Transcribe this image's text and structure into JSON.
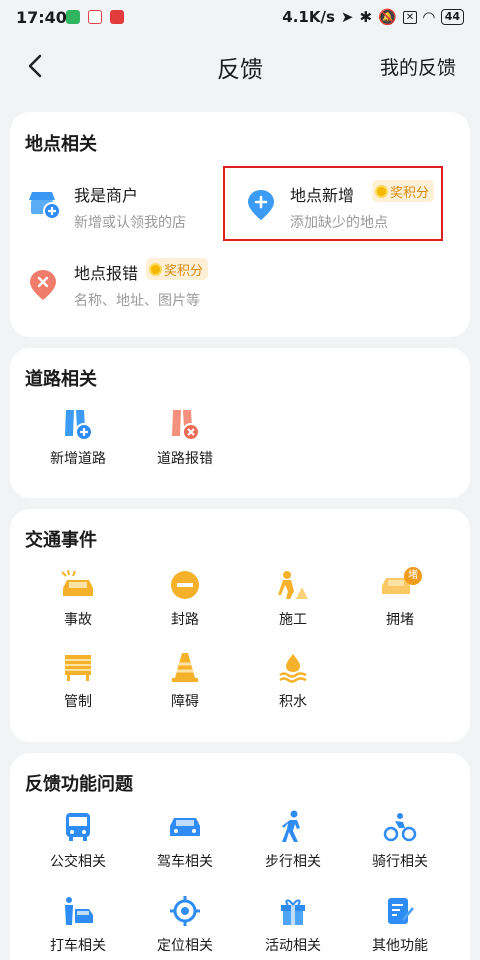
{
  "status_bar": {
    "time": "17:40",
    "network_speed": "4.1K/s",
    "battery": "44"
  },
  "nav": {
    "title": "反馈",
    "my_feedback": "我的反馈"
  },
  "location_section": {
    "title": "地点相关",
    "items": [
      {
        "label": "我是商户",
        "subtitle": "新增或认领我的店"
      },
      {
        "label": "地点新增",
        "subtitle": "添加缺少的地点",
        "badge": "奖积分"
      },
      {
        "label": "地点报错",
        "subtitle": "名称、地址、图片等",
        "badge": "奖积分"
      }
    ]
  },
  "road_section": {
    "title": "道路相关",
    "items": [
      {
        "label": "新增道路"
      },
      {
        "label": "道路报错"
      }
    ]
  },
  "traffic_section": {
    "title": "交通事件",
    "items": [
      {
        "label": "事故"
      },
      {
        "label": "封路"
      },
      {
        "label": "施工"
      },
      {
        "label": "拥堵",
        "icon_text": "堵"
      },
      {
        "label": "管制"
      },
      {
        "label": "障碍"
      },
      {
        "label": "积水"
      }
    ]
  },
  "feature_section": {
    "title": "反馈功能问题",
    "items": [
      {
        "label": "公交相关"
      },
      {
        "label": "驾车相关"
      },
      {
        "label": "步行相关"
      },
      {
        "label": "骑行相关"
      },
      {
        "label": "打车相关"
      },
      {
        "label": "定位相关"
      },
      {
        "label": "活动相关"
      },
      {
        "label": "其他功能"
      }
    ]
  },
  "colors": {
    "accent_blue": "#2f8cf5",
    "orange": "#f5b12a",
    "red_marker": "#f07d6b",
    "badge_bg": "#fdf0d6",
    "badge_text": "#d78a12"
  }
}
